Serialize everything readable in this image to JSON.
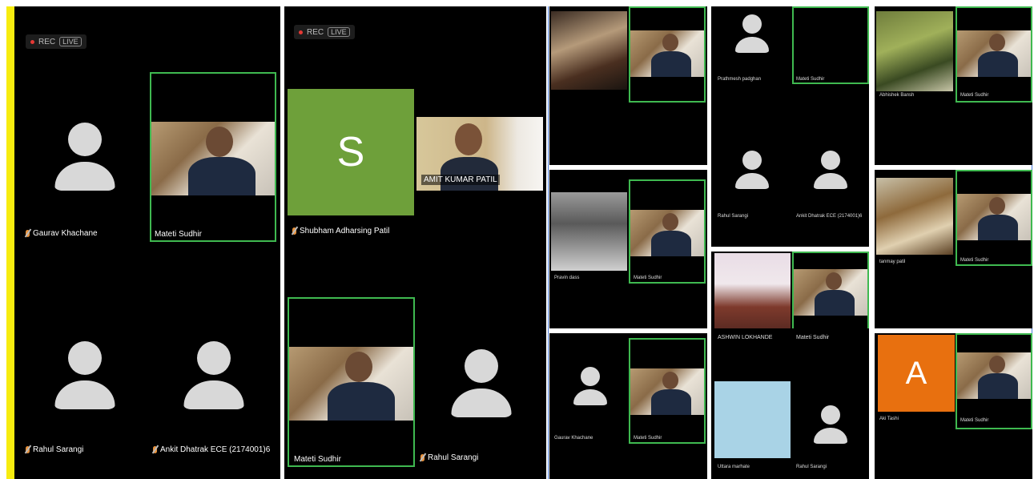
{
  "panel1": {
    "rec_label": "REC",
    "live_label": "LIVE",
    "participants": [
      {
        "name": "Gaurav Khachane"
      },
      {
        "name": "Mateti Sudhir"
      },
      {
        "name": "Rahul Sarangi"
      },
      {
        "name": "Ankit Dhatrak ECE (2174001)6"
      }
    ]
  },
  "panel2": {
    "rec_label": "REC",
    "live_label": "LIVE",
    "avatar_letter": "S",
    "avatar_color": "#6ea03a",
    "participants": [
      {
        "name": "Shubham Adharsing Patil"
      },
      {
        "name": "AMIT KUMAR PATIL"
      },
      {
        "name": "Mateti Sudhir"
      },
      {
        "name": "Rahul Sarangi"
      }
    ]
  },
  "collage": {
    "tiles": [
      {
        "left_name": "",
        "right_name": ""
      },
      {
        "left_name": "Prathmesh padghan",
        "right_name": "Mateti Sudhir"
      },
      {
        "left_name": "Abhishek Bansh",
        "right_name": "Mateti Sudhir"
      },
      {
        "left_name": "Pravin dass",
        "right_name": "Mateti Sudhir"
      },
      {
        "left_name": "Rahul Sarangi",
        "right_name": "Ankit Dhatrak ECE (2174001)6"
      },
      {
        "left_name": "tanmay patil",
        "right_name": "Mateti Sudhir"
      },
      {
        "left_name": "Gaurav Khachane",
        "right_name": "Mateti Sudhir"
      },
      {
        "left_name": "ASHWIN LOKHANDE",
        "right_name": "Mateti Sudhir"
      },
      {
        "left_name": "Aki Tashi",
        "right_name": "Mateti Sudhir"
      },
      {
        "left_name": "Uttara marhate",
        "right_name": "Rahul Sarangi"
      }
    ],
    "letter_avatar": "A",
    "letter_avatar_color": "#e8700f",
    "blank_tile_color": "#a9d3e6"
  },
  "colors": {
    "accent_green": "#3fb950",
    "left_border_yellow": "#f7ec0f",
    "collage_border_blue": "#4a7bd8"
  }
}
